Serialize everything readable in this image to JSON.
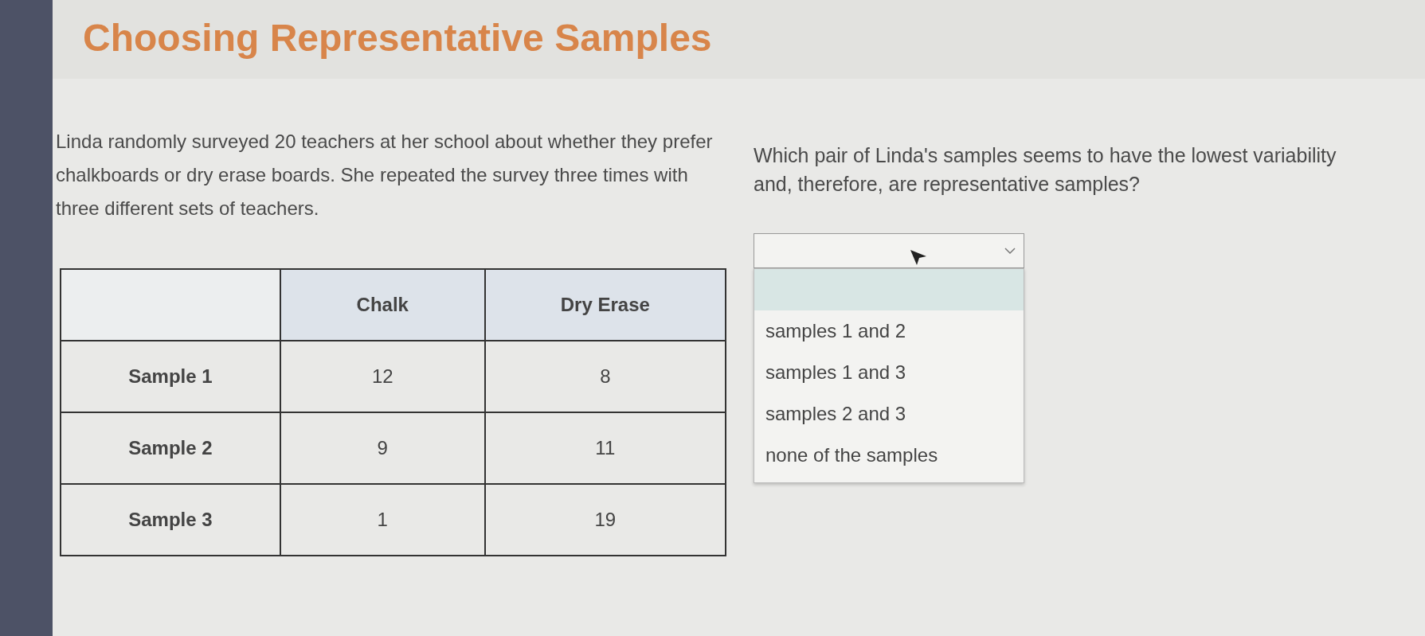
{
  "title": "Choosing Representative Samples",
  "passage": "Linda randomly surveyed 20 teachers at her school about whether they prefer chalkboards or dry erase boards. She repeated the survey three times with three different sets of teachers.",
  "table": {
    "columns": [
      "Chalk",
      "Dry Erase"
    ],
    "rows": [
      {
        "label": "Sample 1",
        "cells": [
          "12",
          "8"
        ]
      },
      {
        "label": "Sample 2",
        "cells": [
          "9",
          "11"
        ]
      },
      {
        "label": "Sample 3",
        "cells": [
          "1",
          "19"
        ]
      }
    ]
  },
  "question": "Which pair of Linda's samples seems to have the lowest variability and, therefore, are representative samples?",
  "dropdown": {
    "expanded": true,
    "options": [
      {
        "label": "samples 1 and 2",
        "selected": false
      },
      {
        "label": "samples 1 and 3",
        "selected": false
      },
      {
        "label": "samples 2 and 3",
        "selected": false
      },
      {
        "label": "none of the samples",
        "selected": false
      }
    ]
  }
}
